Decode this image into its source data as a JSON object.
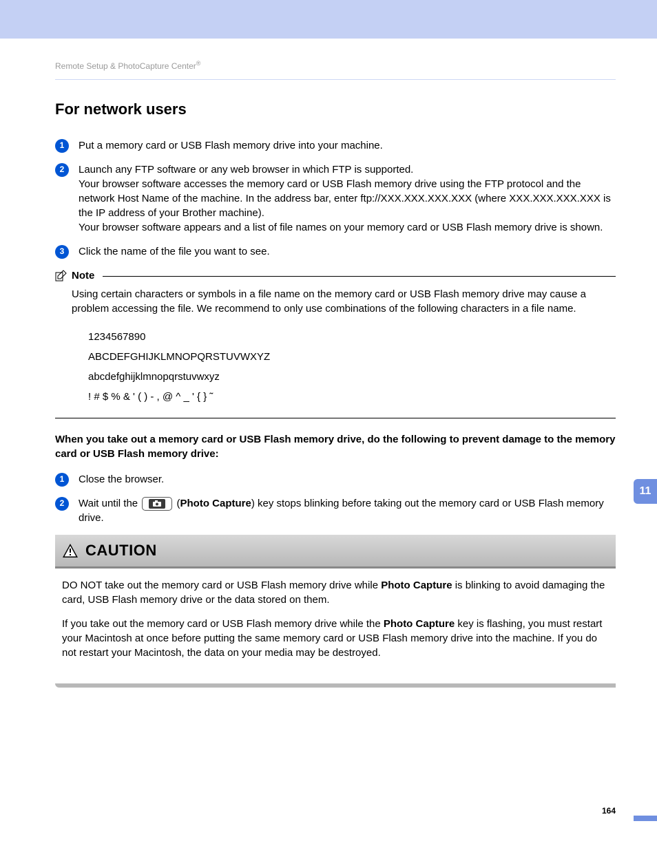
{
  "breadcrumb": {
    "text": "Remote Setup & PhotoCapture Center",
    "reg": "®"
  },
  "heading": "For network users",
  "steps_a": [
    "Put a memory card or USB Flash memory drive into your machine.",
    "Launch any FTP software or any web browser in which FTP is supported.\nYour browser software accesses the memory card or USB Flash memory drive using the FTP protocol and the network Host Name of the machine. In the address bar, enter ftp://XXX.XXX.XXX.XXX (where XXX.XXX.XXX.XXX is the IP address of your Brother machine).\nYour browser software appears and a list of file names on your memory card or USB Flash memory drive is shown.",
    "Click the name of the file you want to see."
  ],
  "note": {
    "label": "Note",
    "body": "Using certain characters or symbols in a file name on the memory card or USB Flash memory drive may cause a problem accessing the file. We recommend to only use combinations of the following characters in a file name.",
    "chars": [
      "1234567890",
      "ABCDEFGHIJKLMNOPQRSTUVWXYZ",
      "abcdefghijklmnopqrstuvwxyz",
      "! # $ % & ' ( ) - , @ ^ _ ' { } ˜"
    ]
  },
  "bold_para": "When you take out a memory card or USB Flash memory drive, do the following to prevent damage to the memory card or USB Flash memory drive:",
  "steps_b": {
    "s1": "Close the browser.",
    "s2_a": "Wait until the ",
    "s2_b": " (",
    "s2_key": "Photo Capture",
    "s2_c": ") key stops blinking before taking out the memory card or USB Flash memory drive."
  },
  "caution": {
    "label": "CAUTION",
    "p1_a": "DO NOT take out the memory card or USB Flash memory drive while ",
    "p1_key": "Photo Capture",
    "p1_b": " is blinking to avoid damaging the card, USB Flash memory drive or the data stored on them.",
    "p2_a": "If you take out the memory card or USB Flash memory drive while the ",
    "p2_key": "Photo Capture",
    "p2_b": " key is flashing, you must restart your Macintosh at once before putting the same memory card or USB Flash memory drive into the machine. If you do not restart your Macintosh, the data on your media may be destroyed."
  },
  "chapter_tab": "11",
  "page_number": "164"
}
